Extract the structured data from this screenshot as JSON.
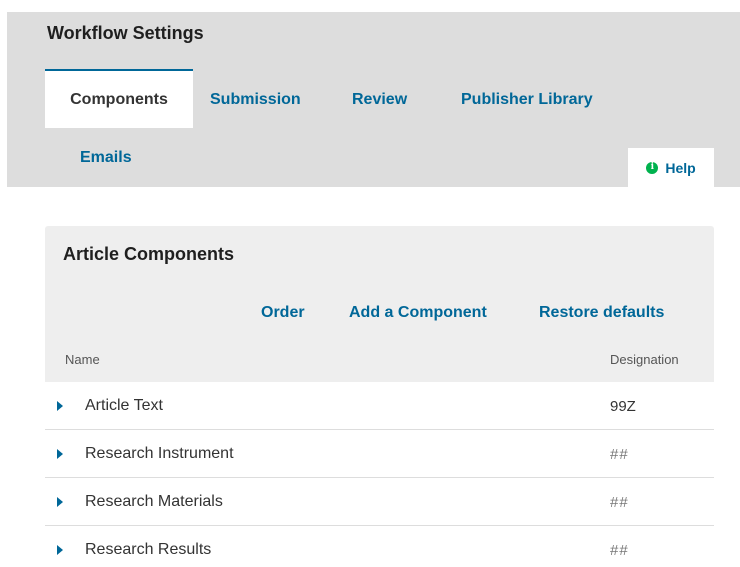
{
  "header": {
    "title": "Workflow Settings",
    "tabs": [
      {
        "label": "Components",
        "active": true
      },
      {
        "label": "Submission",
        "active": false
      },
      {
        "label": "Review",
        "active": false
      },
      {
        "label": "Publisher Library",
        "active": false
      },
      {
        "label": "Emails",
        "active": false
      }
    ],
    "help_label": "Help"
  },
  "panel": {
    "title": "Article Components",
    "actions": {
      "order": "Order",
      "add": "Add a Component",
      "restore": "Restore defaults"
    },
    "columns": {
      "name": "Name",
      "designation": "Designation"
    },
    "rows": [
      {
        "name": "Article Text",
        "designation": "99Z"
      },
      {
        "name": "Research Instrument",
        "designation": "##"
      },
      {
        "name": "Research Materials",
        "designation": "##"
      },
      {
        "name": "Research Results",
        "designation": "##"
      }
    ]
  },
  "colors": {
    "accent": "#006798",
    "help_icon": "#00b24e",
    "header_bg": "#dddddd",
    "panel_bg": "#eeeeee"
  }
}
